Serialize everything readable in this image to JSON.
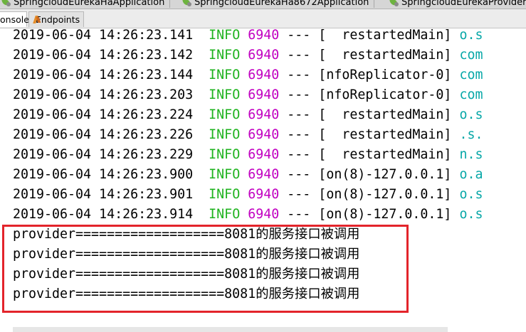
{
  "run_tabs": [
    {
      "label": "SpringcloudEurekaHaApplication"
    },
    {
      "label": "SpringcloudEurekaHa8672Application"
    },
    {
      "label": "SpringcloudEurekaProviderA"
    }
  ],
  "sub_tabs": [
    {
      "label": "onsole",
      "active": true
    },
    {
      "label": "Endpoints",
      "active": false
    }
  ],
  "log_lines": [
    {
      "date": "2019-06-04",
      "time": "14:26:23.141",
      "level": "INFO",
      "pid": "6940",
      "sep": "---",
      "thread": "[  restartedMain]",
      "logger": "o.s"
    },
    {
      "date": "2019-06-04",
      "time": "14:26:23.142",
      "level": "INFO",
      "pid": "6940",
      "sep": "---",
      "thread": "[  restartedMain]",
      "logger": "com"
    },
    {
      "date": "2019-06-04",
      "time": "14:26:23.144",
      "level": "INFO",
      "pid": "6940",
      "sep": "---",
      "thread": "[nfoReplicator-0]",
      "logger": "com"
    },
    {
      "date": "2019-06-04",
      "time": "14:26:23.203",
      "level": "INFO",
      "pid": "6940",
      "sep": "---",
      "thread": "[nfoReplicator-0]",
      "logger": "com"
    },
    {
      "date": "2019-06-04",
      "time": "14:26:23.224",
      "level": "INFO",
      "pid": "6940",
      "sep": "---",
      "thread": "[  restartedMain]",
      "logger": "o.s"
    },
    {
      "date": "2019-06-04",
      "time": "14:26:23.226",
      "level": "INFO",
      "pid": "6940",
      "sep": "---",
      "thread": "[  restartedMain]",
      "logger": ".s."
    },
    {
      "date": "2019-06-04",
      "time": "14:26:23.229",
      "level": "INFO",
      "pid": "6940",
      "sep": "---",
      "thread": "[  restartedMain]",
      "logger": "n.s"
    },
    {
      "date": "2019-06-04",
      "time": "14:26:23.900",
      "level": "INFO",
      "pid": "6940",
      "sep": "---",
      "thread": "[on(8)-127.0.0.1]",
      "logger": "o.a"
    },
    {
      "date": "2019-06-04",
      "time": "14:26:23.901",
      "level": "INFO",
      "pid": "6940",
      "sep": "---",
      "thread": "[on(8)-127.0.0.1]",
      "logger": "o.s"
    },
    {
      "date": "2019-06-04",
      "time": "14:26:23.914",
      "level": "INFO",
      "pid": "6940",
      "sep": "---",
      "thread": "[on(8)-127.0.0.1]",
      "logger": "o.s"
    }
  ],
  "provider_lines": [
    {
      "prefix": "provider===================8081",
      "message": "的服务接口被调用"
    },
    {
      "prefix": "provider===================8081",
      "message": "的服务接口被调用"
    },
    {
      "prefix": "provider===================8081",
      "message": "的服务接口被调用"
    },
    {
      "prefix": "provider===================8081",
      "message": "的服务接口被调用"
    }
  ],
  "colors": {
    "info_level": "#1fb31f",
    "pid": "#c100c1",
    "logger": "#06a7a7",
    "highlight_border": "#e3242b"
  }
}
